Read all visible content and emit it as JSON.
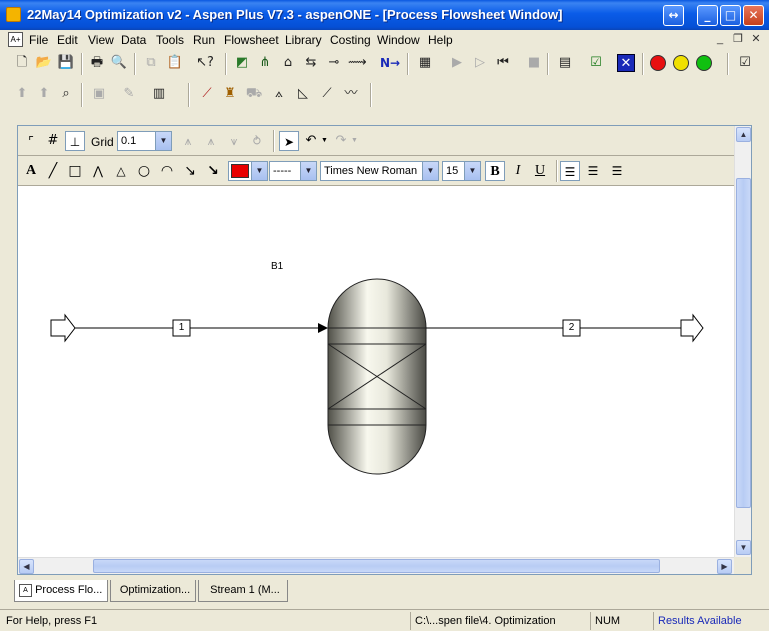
{
  "window": {
    "title": "22May14 Optimization v2 - Aspen Plus V7.3 - aspenONE - [Process Flowsheet Window]",
    "restore_glyph": "↔",
    "minimize_glyph": "_",
    "maximize_glyph": "□",
    "close_glyph": "✕"
  },
  "menubar": {
    "doc_icon": "A+",
    "items": [
      "File",
      "Edit",
      "View",
      "Data",
      "Tools",
      "Run",
      "Flowsheet",
      "Library",
      "Costing",
      "Window",
      "Help"
    ],
    "mdi_minimize": "_",
    "mdi_restore": "❐",
    "mdi_close": "✕"
  },
  "toolbar1": {
    "icons": [
      "new-file-icon",
      "open-folder-icon",
      "save-icon",
      "print-icon",
      "print-preview-icon",
      "copy-icon",
      "paste-icon",
      "whats-this-help-icon",
      "data-browser-icon",
      "flowsheet-connect-icon",
      "model-library-icon",
      "stream-icon",
      "sensitivity-icon",
      "design-spec-icon",
      "next-icon",
      "control-panel-icon",
      "run-icon",
      "step-icon",
      "reinitialize-icon",
      "stop-icon",
      "results-icon",
      "check-results-icon",
      "cancel-icon"
    ],
    "next_label": "N→",
    "status_lights": {
      "red": "#e81010",
      "yellow": "#f0e000",
      "green": "#10c010"
    }
  },
  "toolbar2": {
    "icons": [
      "unit-op-icon",
      "stream-table-icon",
      "zoom-icon",
      "flowsheet-display-icon",
      "annotation-icon",
      "plot-icon",
      "plot-wizard-icon",
      "property-analysis-icon",
      "binary-analysis-icon",
      "pressure-analysis-icon",
      "plot-x-icon",
      "plot-y-icon"
    ]
  },
  "drawing_toolbar": {
    "grid_label": "Grid",
    "grid_value": "0.1",
    "font_name": "Times New Roman",
    "font_size": "15",
    "bold_label": "B",
    "italic_label": "I",
    "underline_label": "U",
    "text_tool_label": "A",
    "line_style": "-----",
    "fill_color": "#e80000"
  },
  "flowsheet": {
    "block_label": "B1",
    "stream_in_label": "1",
    "stream_out_label": "2"
  },
  "tabs": [
    "Process Flo...",
    "Optimization...",
    "Stream 1 (M..."
  ],
  "statusbar": {
    "help": "For Help, press F1",
    "path": "C:\\...spen file\\4. Optimization",
    "num": "NUM",
    "results": "Results Available"
  }
}
